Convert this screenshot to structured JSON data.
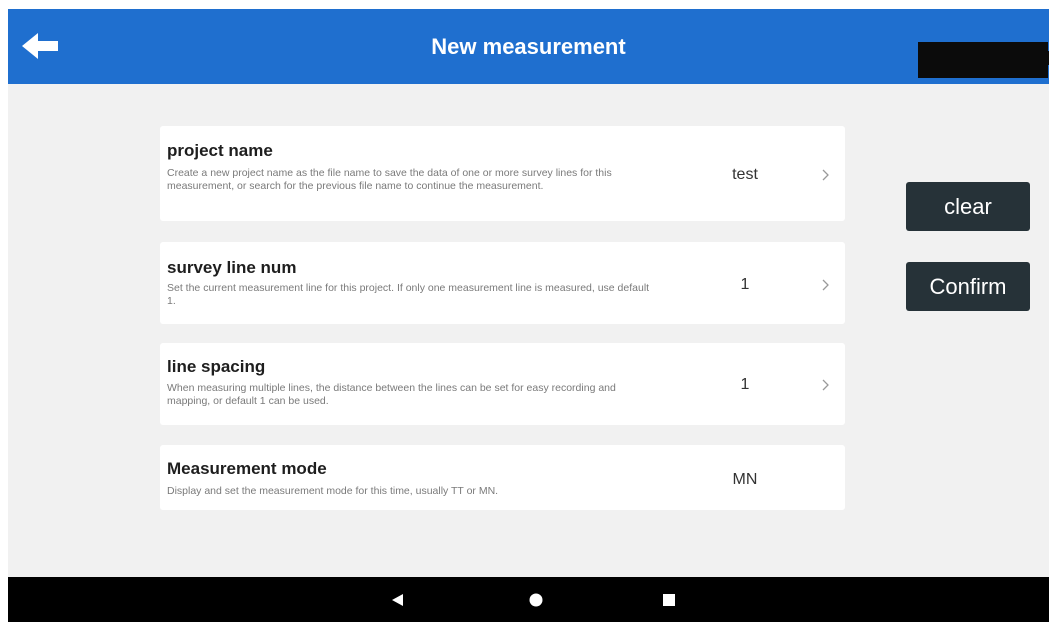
{
  "app_bar": {
    "title": "New measurement",
    "background_color": "#1f6fcf",
    "back_icon": "arrow-left-icon"
  },
  "settings": [
    {
      "title": "project name",
      "description": "Create a new project name as the file name to save the data of one or more survey lines for this measurement, or search for the previous file name to continue the measurement.",
      "value": "test",
      "has_chevron": true
    },
    {
      "title": "survey line num",
      "description": "Set the current measurement line for this project. If only one measurement line is measured, use default 1.",
      "value": "1",
      "has_chevron": true
    },
    {
      "title": "line spacing",
      "description": "When measuring multiple lines, the distance between the lines can be set for easy recording and mapping, or default 1 can be used.",
      "value": "1",
      "has_chevron": true
    },
    {
      "title": "Measurement mode",
      "description": "Display and set the measurement mode for this time, usually TT or MN.",
      "value": "MN",
      "has_chevron": false
    }
  ],
  "actions": {
    "clear_label": "clear",
    "confirm_label": "Confirm",
    "button_color": "#263238"
  },
  "nav_bar": {
    "icons": [
      "nav-back-icon",
      "nav-home-icon",
      "nav-recents-icon"
    ]
  }
}
